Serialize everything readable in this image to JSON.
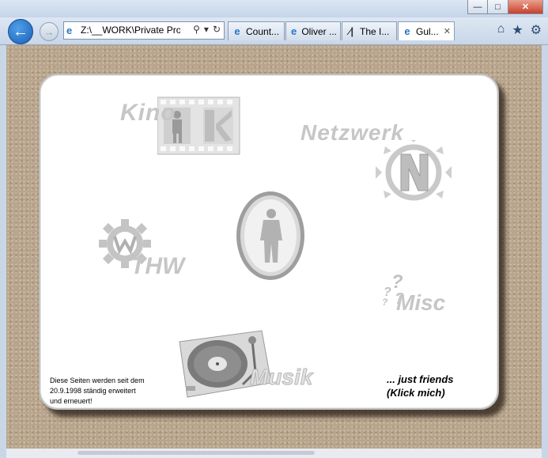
{
  "browser": {
    "address": "Z:\\__WORK\\Private Proj",
    "tabs": [
      {
        "title": "Count...",
        "icon": "ie-page-icon",
        "active": false
      },
      {
        "title": "Oliver ...",
        "icon": "ie-page-icon",
        "active": false
      },
      {
        "title": "The I...",
        "icon": "site-logo-icon",
        "active": false
      },
      {
        "title": "Gul...",
        "icon": "ie-page-icon",
        "active": true
      }
    ],
    "window_controls": {
      "minimize": "—",
      "maximize": "□",
      "close": "✕"
    },
    "nav_glyphs": {
      "back": "←",
      "forward": "→"
    }
  },
  "page": {
    "sections": {
      "kino": "Kino",
      "netzwerk": "Netzwerk",
      "thw": "THW",
      "misc": "Misc",
      "musik": "Musik"
    },
    "footer_note": [
      "Diese Seiten werden seit dem",
      "20.9.1998 ständig erweitert",
      "und erneuert!"
    ],
    "friends_link": [
      "... just friends",
      "(Klick mich)"
    ]
  },
  "colors": {
    "page_background": "#b9a58c",
    "card_background": "#ffffff",
    "label_gray": "#c6c6c6",
    "browser_accent": "#1a5fb8"
  }
}
